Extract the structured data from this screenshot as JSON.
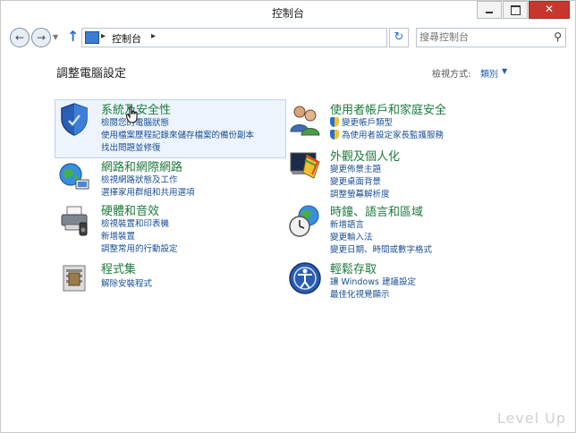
{
  "window": {
    "title": "控制台"
  },
  "address": {
    "path": "控制台",
    "search_placeholder": "搜尋控制台"
  },
  "page": {
    "heading": "調整電腦設定",
    "view_by_label": "檢視方式:",
    "view_by_value": "類別"
  },
  "categories_left": [
    {
      "title": "系統及安全性",
      "links": [
        "檢閱您的電腦狀態",
        "使用檔案歷程記錄來儲存檔案的備份副本",
        "找出問題並修復"
      ]
    },
    {
      "title": "網路和網際網路",
      "links": [
        "檢視網路狀態及工作",
        "選擇家用群組和共用選項"
      ]
    },
    {
      "title": "硬體和音效",
      "links": [
        "檢視裝置和印表機",
        "新增裝置",
        "調整常用的行動設定"
      ]
    },
    {
      "title": "程式集",
      "links": [
        "解除安裝程式"
      ]
    }
  ],
  "categories_right": [
    {
      "title": "使用者帳戶和家庭安全",
      "links": [
        "變更帳戶類型",
        "為使用者設定家長監護服務"
      ]
    },
    {
      "title": "外觀及個人化",
      "links": [
        "變更佈景主題",
        "變更桌面背景",
        "調整螢幕解析度"
      ]
    },
    {
      "title": "時鐘、語言和區域",
      "links": [
        "新增語言",
        "變更輸入法",
        "變更日期、時間或數字格式"
      ]
    },
    {
      "title": "輕鬆存取",
      "links": [
        "讓 Windows 建議設定",
        "最佳化視覺顯示"
      ]
    }
  ],
  "watermark": "Level Up",
  "colors": {
    "category_title": "#1e7a3e",
    "link": "#1a4f96",
    "hover_bg": "#edf4fb"
  }
}
